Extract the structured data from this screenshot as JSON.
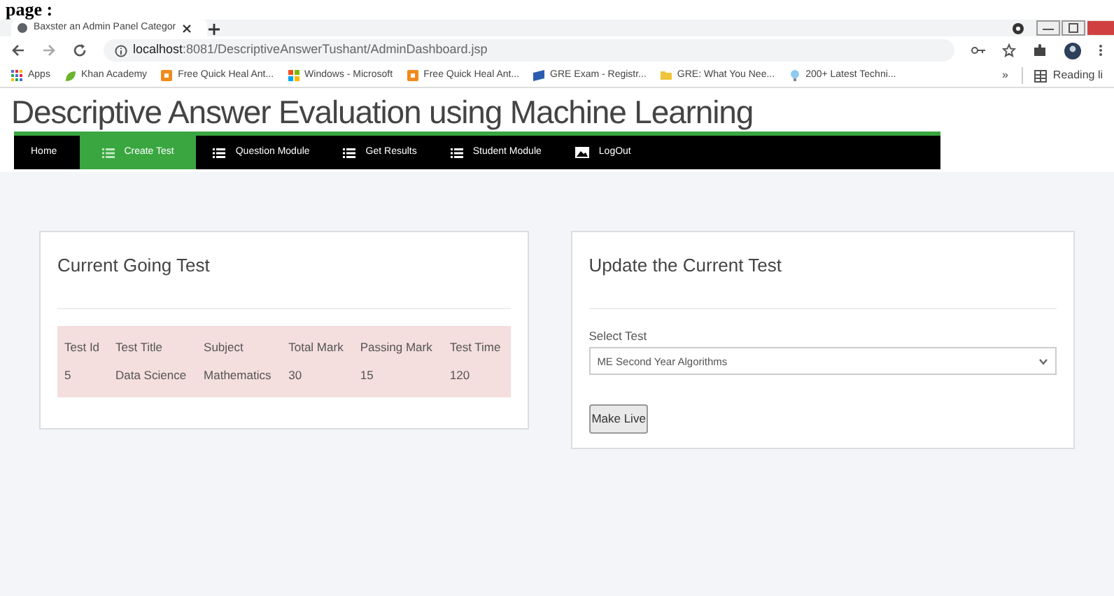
{
  "caption": "page :",
  "browser": {
    "tab": {
      "title": "Baxster an Admin Panel Categor",
      "selected": true
    },
    "url_host": "localhost",
    "url_rest": ":8081/DescriptiveAnswerTushant/AdminDashboard.jsp",
    "bookmarks": [
      {
        "label": "Apps",
        "kind": "apps"
      },
      {
        "label": "Khan Academy",
        "kind": "leaf"
      },
      {
        "label": "Free Quick Heal Ant...",
        "kind": "orange"
      },
      {
        "label": "Windows - Microsoft",
        "kind": "windows"
      },
      {
        "label": "Free Quick Heal Ant...",
        "kind": "orange"
      },
      {
        "label": "GRE Exam - Registr...",
        "kind": "flag"
      },
      {
        "label": "GRE: What You Nee...",
        "kind": "folder"
      },
      {
        "label": "200+ Latest Techni...",
        "kind": "bulb"
      }
    ],
    "overflow": "»",
    "reading_list": "Reading li"
  },
  "page": {
    "title": "Descriptive Answer Evaluation using Machine Learning",
    "nav": [
      {
        "label": "Home",
        "selected": false,
        "kind": "plain"
      },
      {
        "label": "Create Test",
        "selected": true,
        "kind": "list"
      },
      {
        "label": "Question Module",
        "selected": false,
        "kind": "list"
      },
      {
        "label": "Get Results",
        "selected": false,
        "kind": "list"
      },
      {
        "label": "Student Module",
        "selected": false,
        "kind": "list"
      },
      {
        "label": "LogOut",
        "selected": false,
        "kind": "image"
      }
    ],
    "current_test": {
      "title": "Current Going Test",
      "columns": [
        "Test Id",
        "Test Title",
        "Subject",
        "Total Mark",
        "Passing Mark",
        "Test Time"
      ],
      "rows": [
        [
          "5",
          "Data Science",
          "Mathematics",
          "30",
          "15",
          "120"
        ]
      ]
    },
    "update_test": {
      "title": "Update the Current Test",
      "label": "Select Test",
      "value": "ME Second Year Algorithms",
      "button": "Make Live"
    }
  }
}
